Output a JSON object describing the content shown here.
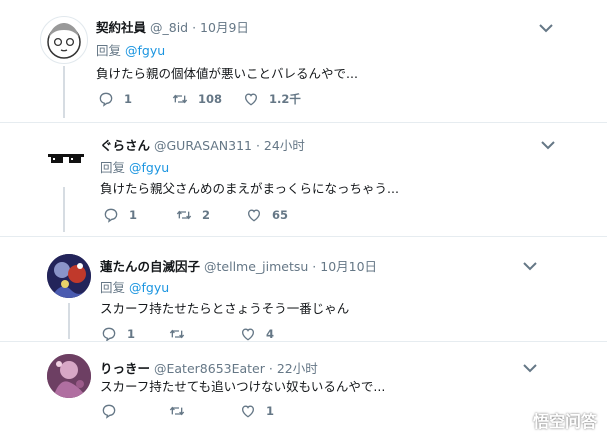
{
  "tweets": [
    {
      "name": "契約社員",
      "handle": "@_8id",
      "time": "· 10月9日",
      "reply_prefix": "回复",
      "reply_to": "@fgyu",
      "text": "負けたら親の個体値が悪いことバレるんやで...",
      "reply_count": "1",
      "retweet_count": "108",
      "like_count": "1.2千"
    },
    {
      "name": "ぐらさん",
      "handle": "@GURASAN311",
      "time": "· 24小时",
      "reply_prefix": "回复",
      "reply_to": "@fgyu",
      "text": "負けたら親父さんめのまえがまっくらになっちゃう...",
      "reply_count": "1",
      "retweet_count": "2",
      "like_count": "65"
    },
    {
      "name": "蓮たんの自滅因子",
      "handle": "@tellme_jimetsu",
      "time": "· 10月10日",
      "reply_prefix": "回复",
      "reply_to": "@fgyu",
      "text": "スカーフ持たせたらとさょうそう一番じゃん",
      "reply_count": "1",
      "retweet_count": "",
      "like_count": "4"
    },
    {
      "name": "りっきー",
      "handle": "@Eater8653Eater",
      "time": "· 22小时",
      "text": "スカーフ持たせても追いつけない奴もいるんやで...",
      "reply_count": "",
      "retweet_count": "",
      "like_count": "1"
    }
  ],
  "watermark": {
    "text": "悟空问答"
  },
  "colors": {
    "link": "#1b95e0",
    "muted": "#657786",
    "thread_line": "#d6dce2",
    "divider": "#e6ecf0"
  },
  "icons": [
    "reply-icon",
    "retweet-icon",
    "like-icon",
    "chevron-down-icon"
  ]
}
